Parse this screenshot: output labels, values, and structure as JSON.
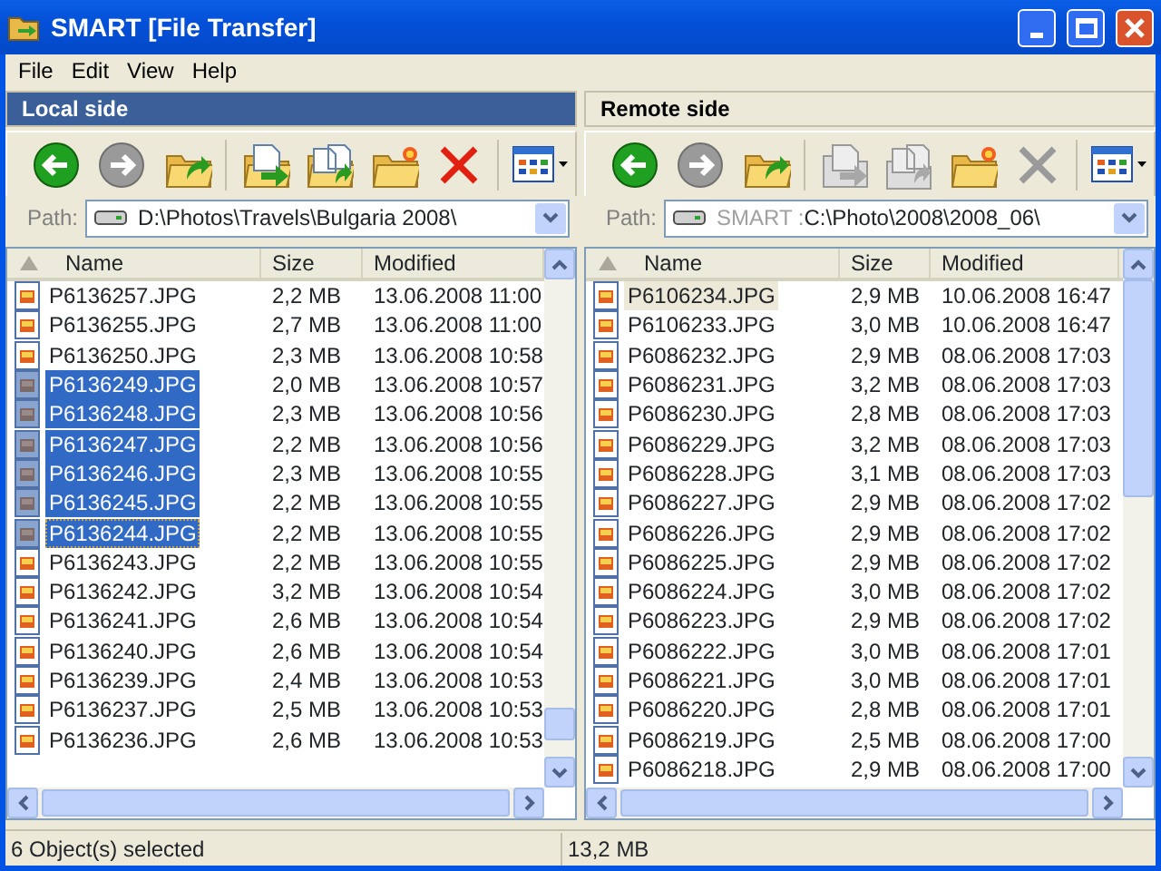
{
  "window": {
    "title": "SMART [File Transfer]"
  },
  "menu": [
    {
      "label": "File"
    },
    {
      "label": "Edit"
    },
    {
      "label": "View"
    },
    {
      "label": "Help"
    }
  ],
  "panes": [
    {
      "title": "Local side",
      "active": true,
      "toolbar": [
        {
          "kind": "back",
          "disabled": false
        },
        {
          "kind": "forward",
          "disabled": true
        },
        {
          "kind": "up",
          "disabled": false
        },
        {
          "kind": "copy",
          "disabled": false
        },
        {
          "kind": "move",
          "disabled": false
        },
        {
          "kind": "newfolder",
          "disabled": false
        },
        {
          "kind": "delete",
          "disabled": false
        },
        {
          "kind": "view",
          "disabled": false
        }
      ],
      "path": {
        "label": "Path:",
        "value": "D:\\Photos\\Travels\\Bulgaria 2008\\"
      },
      "columns": [
        "Name",
        "Size",
        "Modified"
      ],
      "rows": [
        {
          "name": "P6136257.JPG",
          "size": "2,2 MB",
          "modified": "13.06.2008 11:00",
          "selected": false,
          "focused": false
        },
        {
          "name": "P6136255.JPG",
          "size": "2,7 MB",
          "modified": "13.06.2008 11:00",
          "selected": false,
          "focused": false
        },
        {
          "name": "P6136250.JPG",
          "size": "2,3 MB",
          "modified": "13.06.2008 10:58",
          "selected": false,
          "focused": false
        },
        {
          "name": "P6136249.JPG",
          "size": "2,0 MB",
          "modified": "13.06.2008 10:57",
          "selected": true,
          "focused": false
        },
        {
          "name": "P6136248.JPG",
          "size": "2,3 MB",
          "modified": "13.06.2008 10:56",
          "selected": true,
          "focused": false
        },
        {
          "name": "P6136247.JPG",
          "size": "2,2 MB",
          "modified": "13.06.2008 10:56",
          "selected": true,
          "focused": false
        },
        {
          "name": "P6136246.JPG",
          "size": "2,3 MB",
          "modified": "13.06.2008 10:55",
          "selected": true,
          "focused": false
        },
        {
          "name": "P6136245.JPG",
          "size": "2,2 MB",
          "modified": "13.06.2008 10:55",
          "selected": true,
          "focused": false
        },
        {
          "name": "P6136244.JPG",
          "size": "2,2 MB",
          "modified": "13.06.2008 10:55",
          "selected": true,
          "focused": true
        },
        {
          "name": "P6136243.JPG",
          "size": "2,2 MB",
          "modified": "13.06.2008 10:55",
          "selected": false,
          "focused": false
        },
        {
          "name": "P6136242.JPG",
          "size": "3,2 MB",
          "modified": "13.06.2008 10:54",
          "selected": false,
          "focused": false
        },
        {
          "name": "P6136241.JPG",
          "size": "2,6 MB",
          "modified": "13.06.2008 10:54",
          "selected": false,
          "focused": false
        },
        {
          "name": "P6136240.JPG",
          "size": "2,6 MB",
          "modified": "13.06.2008 10:54",
          "selected": false,
          "focused": false
        },
        {
          "name": "P6136239.JPG",
          "size": "2,4 MB",
          "modified": "13.06.2008 10:53",
          "selected": false,
          "focused": false
        },
        {
          "name": "P6136237.JPG",
          "size": "2,5 MB",
          "modified": "13.06.2008 10:53",
          "selected": false,
          "focused": false
        },
        {
          "name": "P6136236.JPG",
          "size": "2,6 MB",
          "modified": "13.06.2008 10:53",
          "selected": false,
          "focused": false
        }
      ]
    },
    {
      "title": "Remote side",
      "active": false,
      "toolbar": [
        {
          "kind": "back",
          "disabled": false
        },
        {
          "kind": "forward",
          "disabled": true
        },
        {
          "kind": "up",
          "disabled": false
        },
        {
          "kind": "copy",
          "disabled": true
        },
        {
          "kind": "move",
          "disabled": true
        },
        {
          "kind": "newfolder",
          "disabled": false
        },
        {
          "kind": "delete",
          "disabled": true
        },
        {
          "kind": "view",
          "disabled": false
        }
      ],
      "path": {
        "label": "Path:",
        "host": "SMART :",
        "value": "C:\\Photo\\2008\\2008_06\\"
      },
      "columns": [
        "Name",
        "Size",
        "Modified"
      ],
      "rows": [
        {
          "name": "P6106234.JPG",
          "size": "2,9 MB",
          "modified": "10.06.2008 16:47",
          "selected": false,
          "focused": true
        },
        {
          "name": "P6106233.JPG",
          "size": "3,0 MB",
          "modified": "10.06.2008 16:47",
          "selected": false,
          "focused": false
        },
        {
          "name": "P6086232.JPG",
          "size": "2,9 MB",
          "modified": "08.06.2008 17:03",
          "selected": false,
          "focused": false
        },
        {
          "name": "P6086231.JPG",
          "size": "3,2 MB",
          "modified": "08.06.2008 17:03",
          "selected": false,
          "focused": false
        },
        {
          "name": "P6086230.JPG",
          "size": "2,8 MB",
          "modified": "08.06.2008 17:03",
          "selected": false,
          "focused": false
        },
        {
          "name": "P6086229.JPG",
          "size": "3,2 MB",
          "modified": "08.06.2008 17:03",
          "selected": false,
          "focused": false
        },
        {
          "name": "P6086228.JPG",
          "size": "3,1 MB",
          "modified": "08.06.2008 17:03",
          "selected": false,
          "focused": false
        },
        {
          "name": "P6086227.JPG",
          "size": "2,9 MB",
          "modified": "08.06.2008 17:02",
          "selected": false,
          "focused": false
        },
        {
          "name": "P6086226.JPG",
          "size": "2,9 MB",
          "modified": "08.06.2008 17:02",
          "selected": false,
          "focused": false
        },
        {
          "name": "P6086225.JPG",
          "size": "2,9 MB",
          "modified": "08.06.2008 17:02",
          "selected": false,
          "focused": false
        },
        {
          "name": "P6086224.JPG",
          "size": "3,0 MB",
          "modified": "08.06.2008 17:02",
          "selected": false,
          "focused": false
        },
        {
          "name": "P6086223.JPG",
          "size": "2,9 MB",
          "modified": "08.06.2008 17:02",
          "selected": false,
          "focused": false
        },
        {
          "name": "P6086222.JPG",
          "size": "3,0 MB",
          "modified": "08.06.2008 17:01",
          "selected": false,
          "focused": false
        },
        {
          "name": "P6086221.JPG",
          "size": "3,0 MB",
          "modified": "08.06.2008 17:01",
          "selected": false,
          "focused": false
        },
        {
          "name": "P6086220.JPG",
          "size": "2,8 MB",
          "modified": "08.06.2008 17:01",
          "selected": false,
          "focused": false
        },
        {
          "name": "P6086219.JPG",
          "size": "2,5 MB",
          "modified": "08.06.2008 17:00",
          "selected": false,
          "focused": false
        },
        {
          "name": "P6086218.JPG",
          "size": "2,9 MB",
          "modified": "08.06.2008 17:00",
          "selected": false,
          "focused": false
        }
      ]
    }
  ],
  "status_bar": [
    "6 Object(s) selected",
    "13,2 MB"
  ]
}
